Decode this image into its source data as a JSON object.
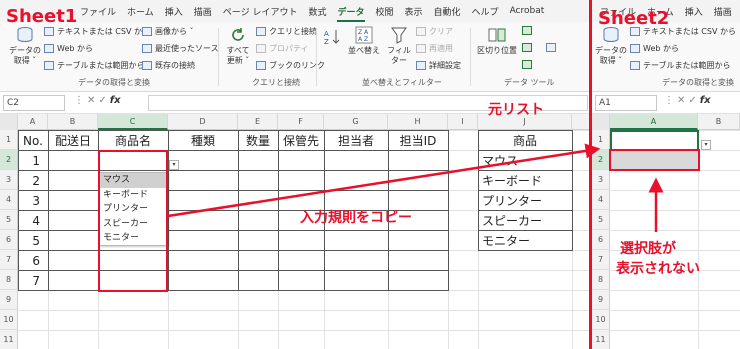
{
  "menu": {
    "tabs": [
      "ファイル",
      "ホーム",
      "挿入",
      "描画",
      "ページ レイアウト",
      "数式",
      "データ",
      "校閲",
      "表示",
      "自動化",
      "ヘルプ",
      "Acrobat"
    ],
    "active": "データ"
  },
  "ribbon": {
    "get_data": "データの\n取得 ˇ",
    "from_text_csv": "テキストまたは CSV から",
    "from_web": "Web から",
    "from_table": "テーブルまたは範囲から",
    "from_image": "画像から ˇ",
    "recent_sources": "最近使ったソース",
    "existing_connections": "既存の接続",
    "group_get": "データの取得と変換",
    "refresh_all": "すべて\n更新 ˇ",
    "queries_connections": "クエリと接続",
    "properties": "プロパティ",
    "workbook_links": "ブックのリンク",
    "group_queries": "クエリと接続",
    "sort": "並べ替え",
    "filter": "フィルター",
    "clear": "クリア",
    "reapply": "再適用",
    "advanced": "詳細設定",
    "group_sort": "並べ替えとフィルター",
    "text_to_columns": "区切り位置",
    "group_tools": "データ ツール"
  },
  "left": {
    "sheet_label": "Sheet1",
    "name_box": "C2",
    "fx": "fx",
    "columns": [
      "A",
      "B",
      "C",
      "D",
      "E",
      "F",
      "G",
      "H",
      "I",
      "J"
    ],
    "rows": [
      "1",
      "2",
      "3",
      "4",
      "5",
      "6",
      "7",
      "8",
      "9",
      "10",
      "11"
    ],
    "headers": [
      "No.",
      "配送日",
      "商品名",
      "種類",
      "数量",
      "保管先",
      "担当者",
      "担当ID"
    ],
    "row_numbers": [
      "1",
      "2",
      "3",
      "4",
      "5",
      "6",
      "7"
    ],
    "list_header": "商品",
    "list_items": [
      "マウス",
      "キーボード",
      "プリンター",
      "スピーカー",
      "モニター"
    ],
    "dropdown_items": [
      "マウス",
      "キーボード",
      "プリンター",
      "スピーカー",
      "モニター"
    ],
    "dropdown_arrow": "▾",
    "annotation_source": "元リスト",
    "annotation_copy": "入力規則をコピー"
  },
  "right": {
    "sheet_label": "Sheet2",
    "name_box": "A1",
    "fx": "fx",
    "columns": [
      "A",
      "B"
    ],
    "rows": [
      "1",
      "2",
      "3",
      "4",
      "5",
      "6",
      "7",
      "8",
      "9",
      "10",
      "11"
    ],
    "from_text_csv": "テキストまたは CSV から",
    "from_web": "Web から",
    "from_table": "テーブルまたは範囲から",
    "get_data": "データの\n取得 ˇ",
    "group_get": "データの取得と変換",
    "dropdown_arrow": "▾",
    "annotation_no_options_1": "選択肢が",
    "annotation_no_options_2": "表示されない"
  },
  "colors": {
    "accent_red": "#e8102a",
    "excel_green": "#217346",
    "selected_cell_fill": "#d9d9d9"
  }
}
